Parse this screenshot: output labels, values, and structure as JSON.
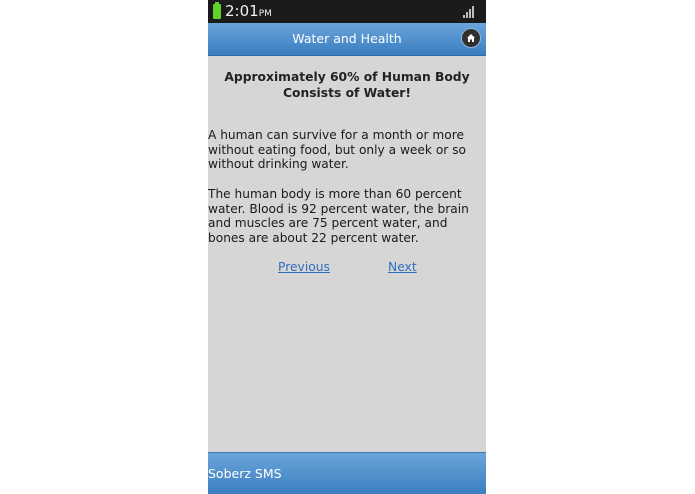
{
  "status_bar": {
    "time": "2:01",
    "ampm": "PM",
    "battery_color": "#5fd32a",
    "icons": [
      "battery-icon",
      "signal-icon"
    ]
  },
  "header": {
    "title": "Water and Health",
    "home_icon": "home-icon",
    "bar_color": "#4a8fcf"
  },
  "main": {
    "heading": "Approximately 60% of Human Body Consists of Water!",
    "paragraphs": [
      "A human can survive for a month or more without eating food, but only a week or so without drinking water.",
      "The human body is more than 60 percent water. Blood is 92 percent water, the brain and muscles are 75 percent water, and bones are about 22 percent water."
    ],
    "prev_label": "Previous",
    "next_label": "Next",
    "link_color": "#2f6fbe"
  },
  "footer": {
    "label": "Soberz SMS"
  }
}
